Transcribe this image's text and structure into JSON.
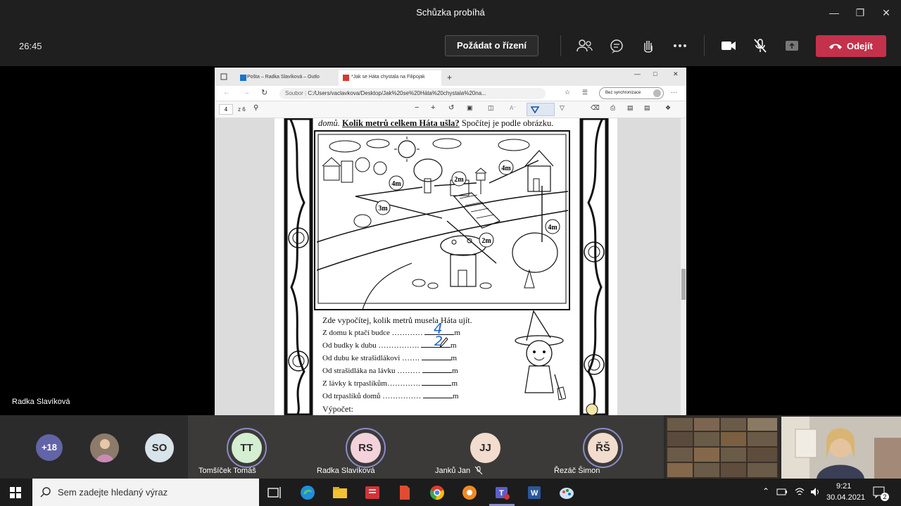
{
  "window": {
    "title": "Schůzka probíhá"
  },
  "toolbar": {
    "timer": "26:45",
    "request_control_label": "Požádat o řízení",
    "leave_label": "Odejít"
  },
  "presenter": {
    "name": "Radka Slavíková"
  },
  "browser": {
    "tabs": [
      {
        "label": "Pošta – Radka Slavíková – Outlo"
      },
      {
        "label": "*Jak se Háta chystala na Filipojak"
      }
    ],
    "url_prefix": "Soubor",
    "url": "C:/Users/vaclavkova/Desktop/Jak%20se%20Háta%20chystala%20na...",
    "sync_label": "Bez synchronizace",
    "page_number": "4",
    "page_total": "z 6"
  },
  "document": {
    "question_start": "domů.",
    "question_bold": "Kolik metrů celkem Háta ušla?",
    "question_end": "Spočítej je podle obrázku.",
    "distance_labels": [
      "4m",
      "2m",
      "4m",
      "3m",
      "4m",
      "2m"
    ],
    "instruction": "Zde vypočítej, kolik metrů musela Háta ujít.",
    "rows": [
      {
        "label": "Z domu k ptačí budce …………",
        "unit": "m",
        "handwritten": "4"
      },
      {
        "label": "Od budky k dubu …………….",
        "unit": "m",
        "handwritten": "2"
      },
      {
        "label": "Od dubu ke strašidlákovi …….",
        "unit": "m",
        "handwritten": ""
      },
      {
        "label": "Od strašidláka na lávku ………",
        "unit": "m",
        "handwritten": ""
      },
      {
        "label": "Z lávky k trpaslíkům………….",
        "unit": "m",
        "handwritten": ""
      },
      {
        "label": "Od trpaslíků domů ……………",
        "unit": "m",
        "handwritten": ""
      }
    ],
    "calc_label": "Výpočet:"
  },
  "participants": {
    "overflow_count": "+18",
    "avatars": [
      {
        "initials": "SO",
        "name": ""
      },
      {
        "initials": "TT",
        "name": "Tomšíček Tomáš"
      },
      {
        "initials": "RS",
        "name": "Radka Slavíková"
      },
      {
        "initials": "JJ",
        "name": "Janků Jan"
      },
      {
        "initials": "ŘŠ",
        "name": "Řezáč Šimon"
      }
    ]
  },
  "taskbar": {
    "search_placeholder": "Sem zadejte hledaný výraz",
    "time": "9:21",
    "date": "30.04.2021",
    "notification_count": "2"
  },
  "colors": {
    "leave": "#c4314b",
    "avatar_ring": "#8b8cc7",
    "handwriting": "#1e66d0"
  }
}
